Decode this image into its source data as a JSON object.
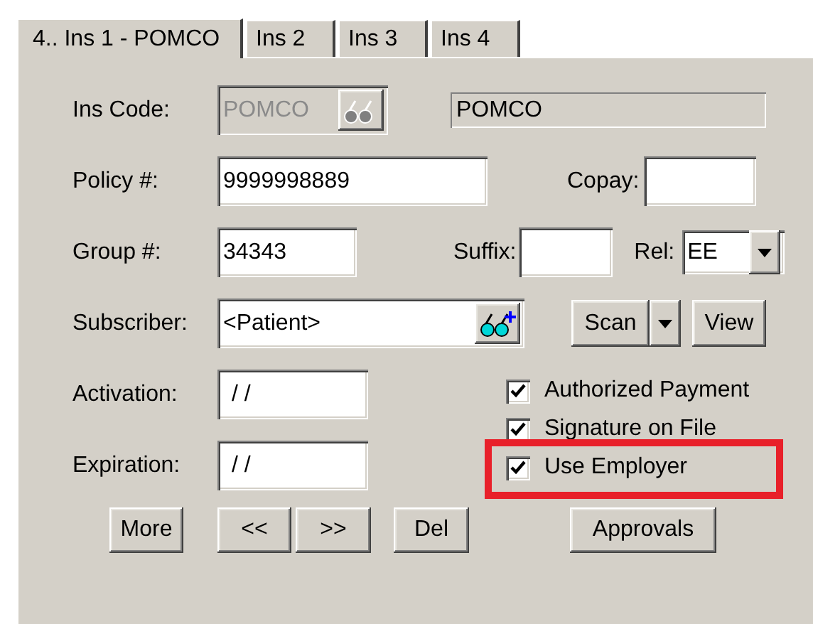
{
  "tabs": [
    {
      "label": "4.. Ins 1 - POMCO",
      "selected": true
    },
    {
      "label": "Ins 2",
      "selected": false
    },
    {
      "label": "Ins 3",
      "selected": false
    },
    {
      "label": "Ins 4",
      "selected": false
    }
  ],
  "ins_code": {
    "label": "Ins Code:",
    "value": "POMCO",
    "disabled": true,
    "name_value": "POMCO"
  },
  "policy": {
    "label": "Policy #:",
    "value": "9999998889"
  },
  "copay": {
    "label": "Copay:"
  },
  "group": {
    "label": "Group #:",
    "value": "34343"
  },
  "suffix": {
    "label": "Suffix:"
  },
  "rel": {
    "label": "Rel:",
    "value": "EE"
  },
  "subscriber": {
    "label": "Subscriber:",
    "value": "<Patient>"
  },
  "scan_button": "Scan",
  "view_button": "View",
  "activation": {
    "label": "Activation:",
    "value": "/ /"
  },
  "expiration": {
    "label": "Expiration:",
    "value": "/ /"
  },
  "checkboxes": [
    {
      "label": "Authorized Payment",
      "checked": true,
      "highlighted": false
    },
    {
      "label": "Signature on File",
      "checked": true,
      "highlighted": false
    },
    {
      "label": "Use Employer",
      "checked": true,
      "highlighted": true
    }
  ],
  "buttons": [
    "More",
    "<<",
    ">>",
    "Del",
    "Approvals"
  ]
}
